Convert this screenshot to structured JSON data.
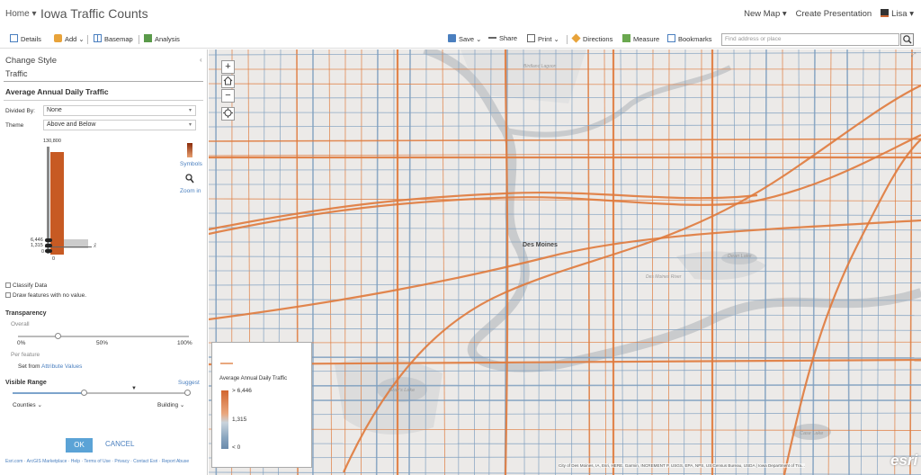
{
  "app": {
    "home": "Home ▾",
    "title": "Iowa Traffic Counts"
  },
  "topright": {
    "new_map": "New Map ▾",
    "create_presentation": "Create Presentation",
    "user": "Lisa ▾"
  },
  "toolbar": {
    "details": "Details",
    "add": "Add ⌄",
    "basemap": "Basemap",
    "analysis": "Analysis",
    "save": "Save ⌄",
    "share": "Share",
    "print": "Print ⌄",
    "directions": "Directions",
    "measure": "Measure",
    "bookmarks": "Bookmarks"
  },
  "search": {
    "placeholder": "Find address or place"
  },
  "panel": {
    "change_style": "Change Style",
    "traffic": "Traffic",
    "heading": "Average Annual Daily Traffic",
    "divided_by_label": "Divided By:",
    "divided_by_value": "None",
    "theme_label": "Theme",
    "theme_value": "Above and Below",
    "hist_max": "130,800",
    "hist_val1": "6,446",
    "hist_val2": "1,315",
    "hist_zero": "0",
    "hist_mean": "x̄",
    "symbols": "Symbols",
    "zoom_in": "Zoom in",
    "classify": "Classify Data",
    "draw_features": "Draw features with no value.",
    "transparency": "Transparency",
    "overall": "Overall",
    "pct0": "0%",
    "pct50": "50%",
    "pct100": "100%",
    "per_feature": "Per feature",
    "set_from": "Set from",
    "attribute_values": "Attribute Values",
    "visible_range": "Visible Range",
    "suggest": "Suggest",
    "counties": "Counties ⌄",
    "building": "Building ⌄",
    "ok": "OK",
    "cancel": "CANCEL",
    "footer": "Esri.com · ArcGIS Marketplace · Help · Terms of Use · Privacy · Contact Esri · Report Abuse"
  },
  "map": {
    "city": "Des Moines",
    "labels": [
      "Birdland Lagoon",
      "Gray's Lake",
      "Dean Lake",
      "Des Moines River",
      "Case Lake"
    ],
    "attribution": "City of Des Moines, IA, Esri, HERE, Garmin, INCREMENT P, USGS, EPA, NPS, US Census Bureau, USDA | Iowa Department of Tra...",
    "logo": "esri"
  },
  "legend": {
    "title": "Average Annual Daily Traffic",
    "high": "> 6,446",
    "mid": "1,315",
    "low": "< 0"
  },
  "colors": {
    "accent": "#4a7fbf",
    "road_orange": "#e07a3c",
    "road_blue": "#7f9fbf",
    "hist_bar": "#c75a23"
  }
}
